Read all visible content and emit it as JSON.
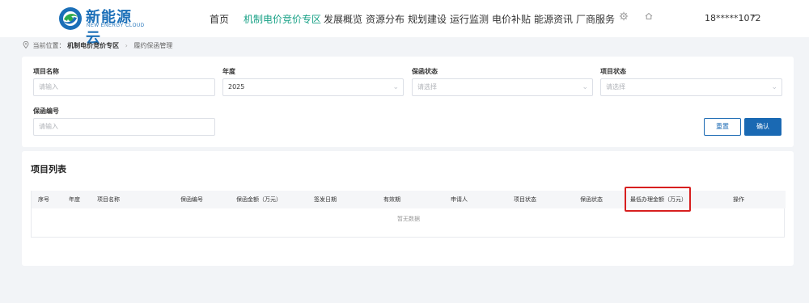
{
  "brand": {
    "name_cn": "新能源云",
    "name_en": "NEW ENERGY CLOUD"
  },
  "nav": {
    "items": [
      {
        "label": "首页"
      },
      {
        "label": "机制电价竞价专区",
        "active": true
      },
      {
        "label": "发展概览"
      },
      {
        "label": "资源分布"
      },
      {
        "label": "规划建设"
      },
      {
        "label": "运行监测"
      },
      {
        "label": "电价补贴"
      },
      {
        "label": "能源资讯"
      },
      {
        "label": "厂商服务"
      }
    ],
    "icons": [
      "settings-icon",
      "home-icon"
    ],
    "user": "18*****1072"
  },
  "breadcrumb": {
    "prefix": "当前位置：",
    "section": "机制电价竞价专区",
    "current": "履约保函管理"
  },
  "filters": {
    "project_name": {
      "label": "项目名称",
      "placeholder": "请输入"
    },
    "year": {
      "label": "年度",
      "value": "2025"
    },
    "guarantee_status": {
      "label": "保函状态",
      "placeholder": "请选择"
    },
    "project_status": {
      "label": "项目状态",
      "placeholder": "请选择"
    },
    "guarantee_no": {
      "label": "保函编号",
      "placeholder": "请输入"
    },
    "reset_label": "重置",
    "confirm_label": "确认"
  },
  "list": {
    "title": "项目列表",
    "columns": [
      "序号",
      "年度",
      "项目名称",
      "保函编号",
      "保函金额（万元）",
      "签发日期",
      "有效期",
      "申请人",
      "项目状态",
      "保函状态",
      "最低办理金额（万元）",
      "操作"
    ],
    "rows": [],
    "empty_text": "暂无数据"
  },
  "colors": {
    "primary": "#1a69b3",
    "nav_active": "#16a085",
    "highlight_border": "#d71f1f"
  }
}
